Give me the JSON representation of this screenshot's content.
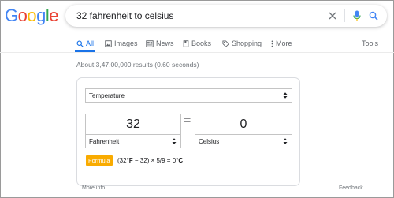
{
  "logo": {
    "letters": [
      "G",
      "o",
      "o",
      "g",
      "l",
      "e"
    ],
    "colors": [
      "#4285f4",
      "#ea4335",
      "#fbbc05",
      "#4285f4",
      "#34a853",
      "#ea4335"
    ]
  },
  "search": {
    "query": "32 fahrenheit to celsius"
  },
  "tabs": [
    {
      "label": "All",
      "icon": "search-icon",
      "active": true
    },
    {
      "label": "Images",
      "icon": "image-icon"
    },
    {
      "label": "News",
      "icon": "news-icon"
    },
    {
      "label": "Books",
      "icon": "book-icon"
    },
    {
      "label": "Shopping",
      "icon": "tag-icon"
    },
    {
      "label": "More",
      "icon": "more-dots-icon"
    }
  ],
  "tools_label": "Tools",
  "results_stats": "About 3,47,00,000 results (0.60 seconds)",
  "converter": {
    "unit_type": "Temperature",
    "from_value": "32",
    "to_value": "0",
    "equals": "=",
    "from_unit": "Fahrenheit",
    "to_unit": "Celsius",
    "formula_label": "Formula",
    "formula_pre": "(32°",
    "formula_f": "F",
    "formula_mid": " − 32) × 5/9 = 0°",
    "formula_c": "C"
  },
  "footer": {
    "more_info": "More info",
    "feedback": "Feedback"
  },
  "colors": {
    "accent": "#1a73e8",
    "formula_badge": "#f9ab00"
  }
}
